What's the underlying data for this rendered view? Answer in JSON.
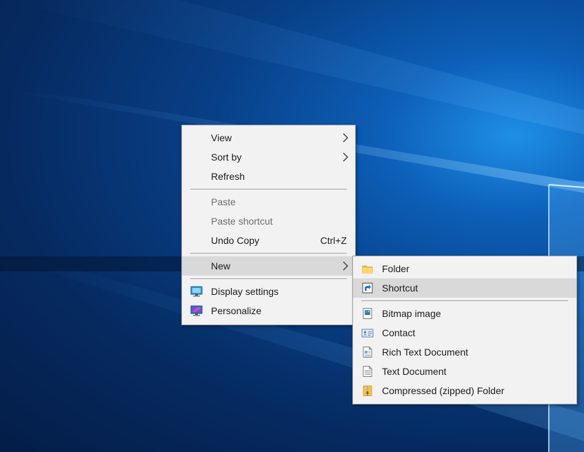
{
  "context_menu": {
    "items": [
      {
        "label": "View",
        "has_submenu": true
      },
      {
        "label": "Sort by",
        "has_submenu": true
      },
      {
        "label": "Refresh"
      },
      {
        "label": "Paste",
        "disabled": true
      },
      {
        "label": "Paste shortcut",
        "disabled": true
      },
      {
        "label": "Undo Copy",
        "shortcut": "Ctrl+Z"
      },
      {
        "label": "New",
        "has_submenu": true,
        "highlighted": true
      },
      {
        "label": "Display settings",
        "icon": "display-settings-icon"
      },
      {
        "label": "Personalize",
        "icon": "personalize-icon"
      }
    ]
  },
  "new_submenu": {
    "items": [
      {
        "label": "Folder",
        "icon": "folder-icon"
      },
      {
        "label": "Shortcut",
        "icon": "shortcut-icon",
        "highlighted": true
      },
      {
        "label": "Bitmap image",
        "icon": "bitmap-image-icon"
      },
      {
        "label": "Contact",
        "icon": "contact-icon"
      },
      {
        "label": "Rich Text Document",
        "icon": "rich-text-document-icon"
      },
      {
        "label": "Text Document",
        "icon": "text-document-icon"
      },
      {
        "label": "Compressed (zipped) Folder",
        "icon": "zip-folder-icon"
      }
    ]
  },
  "colors": {
    "menu_background": "#f2f2f2",
    "highlight": "#d9d9d9",
    "desktop_blue": "#0d5fb8"
  }
}
